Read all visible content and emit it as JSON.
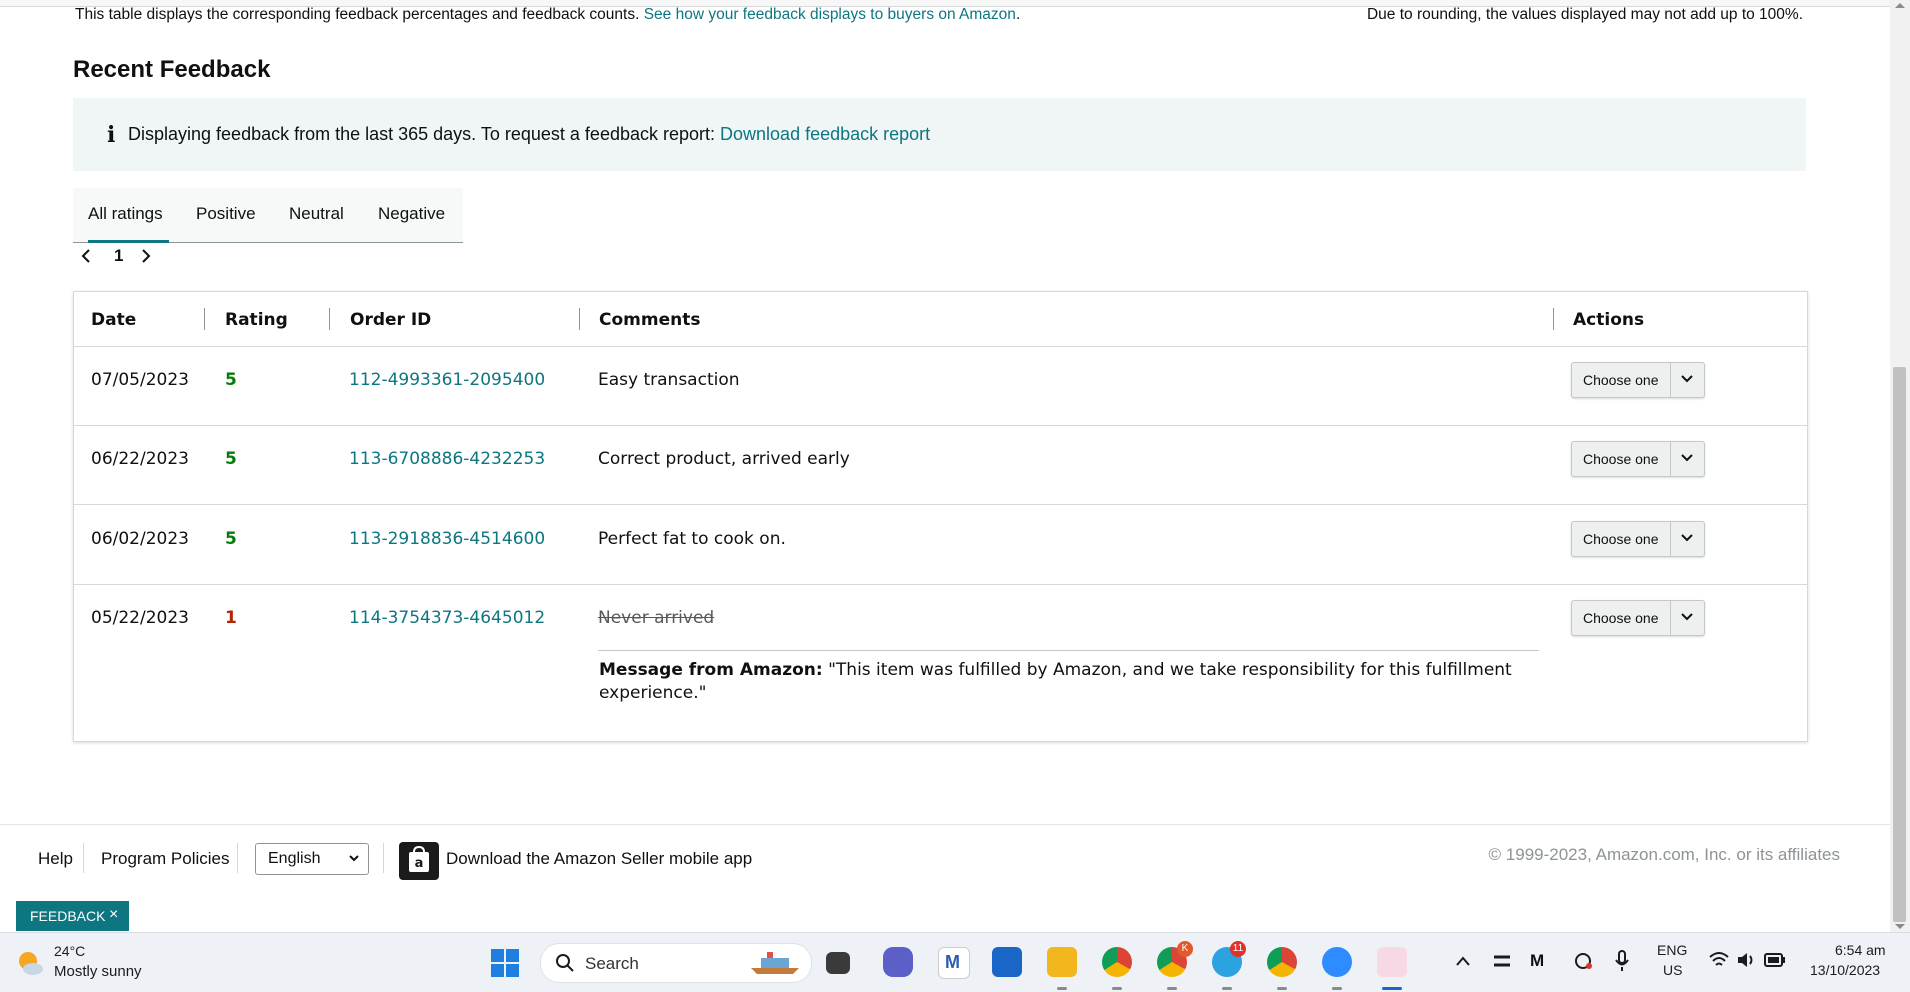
{
  "top_note": {
    "text": "This table displays the corresponding feedback percentages and feedback counts.",
    "link": "See how your feedback displays to buyers on Amazon",
    "right": "Due to rounding, the values displayed may not add up to 100%."
  },
  "section_title": "Recent Feedback",
  "info_banner": {
    "icon": "info-icon",
    "text": "Displaying feedback from the last 365 days. To request a feedback report:",
    "link": "Download feedback report"
  },
  "tabs": [
    {
      "label": "All ratings",
      "active": true
    },
    {
      "label": "Positive",
      "active": false
    },
    {
      "label": "Neutral",
      "active": false
    },
    {
      "label": "Negative",
      "active": false
    }
  ],
  "pager": {
    "page": "1"
  },
  "table": {
    "headers": [
      "Date",
      "Rating",
      "Order ID",
      "Comments",
      "Actions"
    ],
    "rows": [
      {
        "date": "07/05/2023",
        "rating": "5",
        "order_id": "112-4993361-2095400",
        "comment": "Easy transaction",
        "action": "Choose one"
      },
      {
        "date": "06/22/2023",
        "rating": "5",
        "order_id": "113-6708886-4232253",
        "comment": "Correct product, arrived early",
        "action": "Choose one"
      },
      {
        "date": "06/02/2023",
        "rating": "5",
        "order_id": "113-2918836-4514600",
        "comment": "Perfect fat to cook on.",
        "action": "Choose one"
      },
      {
        "date": "05/22/2023",
        "rating": "1",
        "order_id": "114-3754373-4645012",
        "comment": "Never arrived",
        "action": "Choose one",
        "message_label": "Message from Amazon:",
        "message_text": "\"This item was fulfilled by Amazon, and we take responsibility for this fulfillment experience.\""
      }
    ]
  },
  "footer": {
    "help": "Help",
    "policies": "Program Policies",
    "language": "English",
    "app_link": "Download the Amazon Seller mobile app",
    "copyright": "© 1999-2023, Amazon.com, Inc. or its affiliates"
  },
  "feedback_tab": {
    "label": "FEEDBACK",
    "close": "×"
  },
  "taskbar": {
    "temp": "24°C",
    "weather": "Mostly sunny",
    "search": "Search",
    "lang_top": "ENG",
    "lang_bottom": "US",
    "time": "6:54 am",
    "date": "13/10/2023",
    "badge_chrome": "K",
    "badge_telegram": "11"
  },
  "colors": {
    "link": "#0e7680",
    "positive": "#067d06",
    "negative": "#b12704"
  }
}
